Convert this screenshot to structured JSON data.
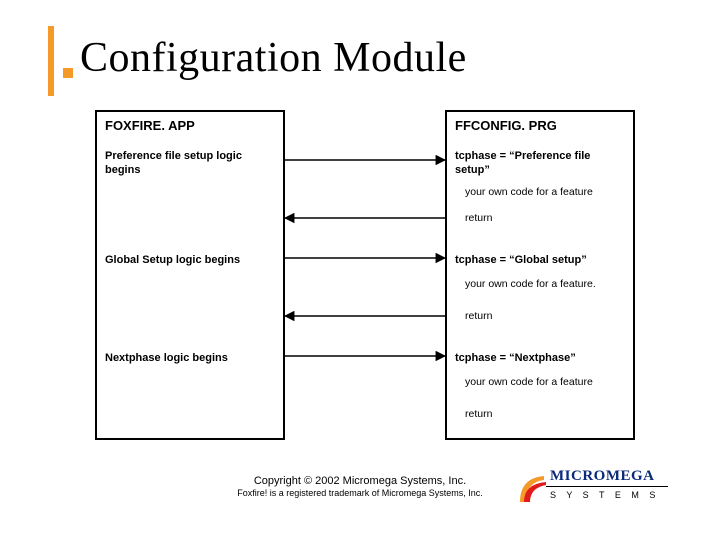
{
  "title": "Configuration Module",
  "left": {
    "header": "FOXFIRE. APP",
    "entry1": "Preference file setup logic begins",
    "entry2": "Global Setup logic begins",
    "entry3": "Nextphase logic begins"
  },
  "right": {
    "header": "FFCONFIG. PRG",
    "block1": {
      "line1": "tcphase = “Preference file setup”",
      "sub1": "your own code for a feature",
      "sub2": "return"
    },
    "block2": {
      "line1": "tcphase = “Global setup”",
      "sub1": "your own code for a feature.",
      "sub2": "return"
    },
    "block3": {
      "line1": "tcphase = “Nextphase”",
      "sub1": "your own code for a feature",
      "sub2": "return"
    }
  },
  "footer": {
    "copyright": "Copyright © 2002 Micromega Systems, Inc.",
    "trademark": "Foxfire! is a registered trademark of Micromega Systems, Inc."
  },
  "logo": {
    "brand": "MICROMEGA",
    "sub": "S Y S T E M S"
  }
}
